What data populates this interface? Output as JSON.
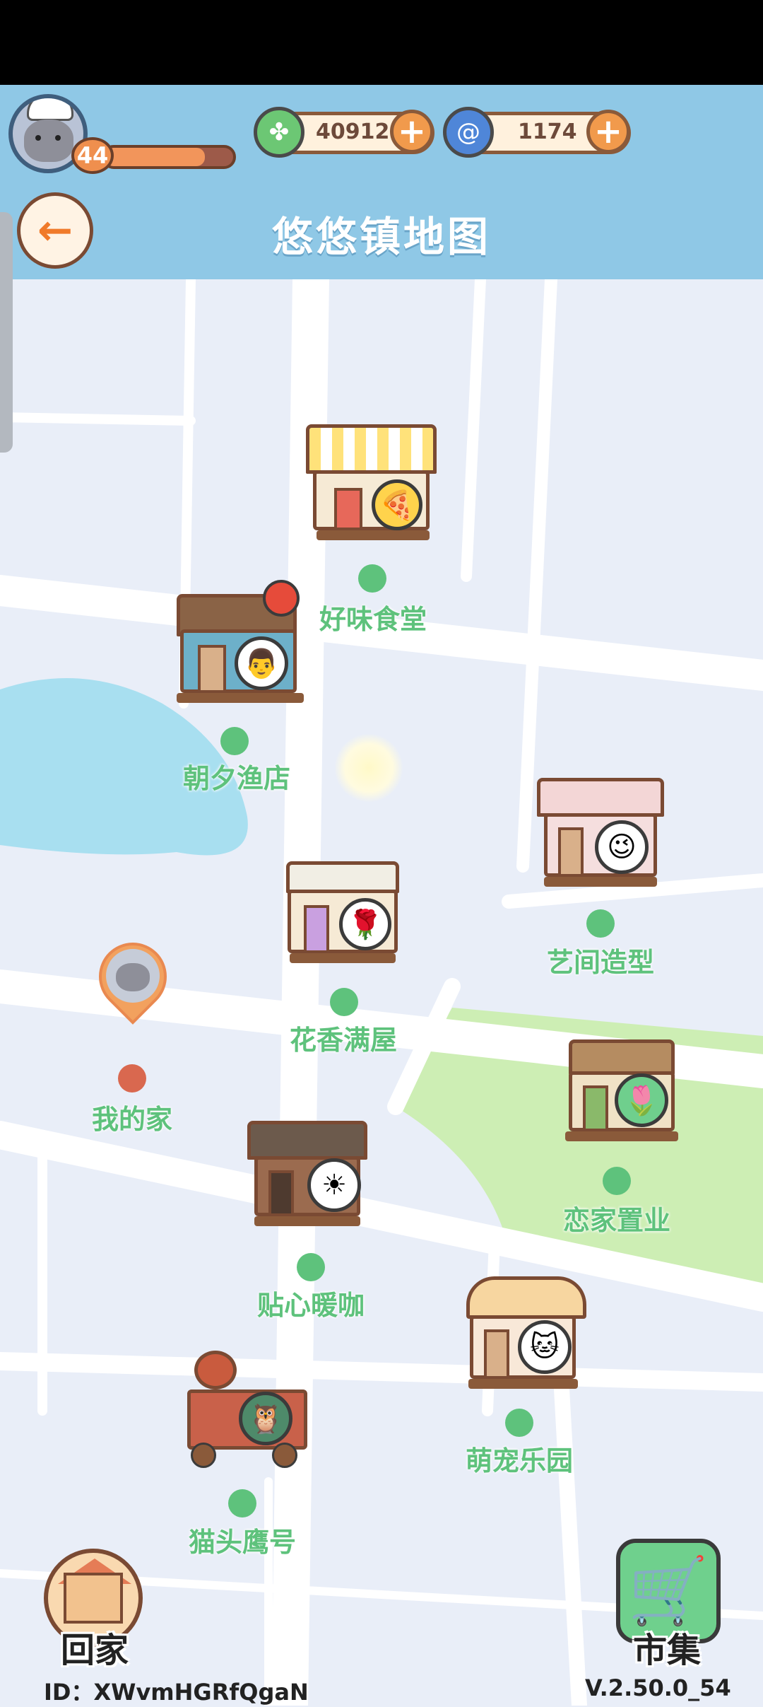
{
  "header": {
    "level": "44",
    "xp_progress": 0.78,
    "currency_clover": "40912",
    "currency_swirl": "1174",
    "title": "悠悠镇地图"
  },
  "icons": {
    "back": "arrow-left-icon",
    "clover": "clover-icon",
    "swirl": "swirl-icon",
    "plus": "plus-icon",
    "home": "house-icon",
    "market": "shopping-cart-icon"
  },
  "locations": [
    {
      "id": "haowei",
      "label": "好味食堂"
    },
    {
      "id": "zhaoxi",
      "label": "朝夕渔店"
    },
    {
      "id": "yijian",
      "label": "艺间造型"
    },
    {
      "id": "huaxiang",
      "label": "花香满屋"
    },
    {
      "id": "wojia",
      "label": "我的家"
    },
    {
      "id": "lianjia",
      "label": "恋家置业"
    },
    {
      "id": "tiexin",
      "label": "贴心暖咖"
    },
    {
      "id": "mengchong",
      "label": "萌宠乐园"
    },
    {
      "id": "maotouying",
      "label": "猫头鹰号"
    }
  ],
  "bottom": {
    "home_label": "回家",
    "market_label": "市集",
    "user_id": "ID：XWvmHGRfQgaN",
    "version": "V.2.50.0_54"
  },
  "colors": {
    "header_bg": "#8fc8e6",
    "map_bg": "#e9eef8",
    "road": "#ffffff",
    "lake": "#a8dff0",
    "park": "#cdeeb4",
    "location_green": "#5ec27c",
    "home_red": "#d9684f",
    "accent_orange": "#f19a4c"
  }
}
